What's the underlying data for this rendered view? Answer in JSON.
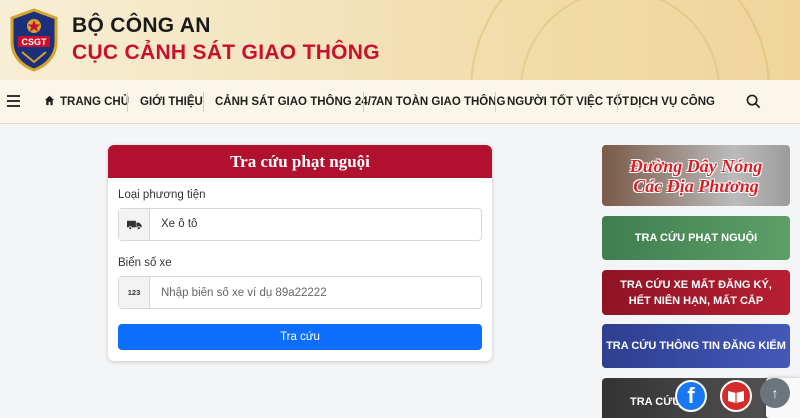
{
  "header": {
    "title_line1": "BỘ CÔNG AN",
    "title_line2": "CỤC CẢNH SÁT GIAO THÔNG",
    "logo_text": "CSGT"
  },
  "nav": {
    "items": [
      {
        "label": "TRANG CHỦ",
        "icon": "home-icon"
      },
      {
        "label": "GIỚI THIỆU"
      },
      {
        "label": "CẢNH SÁT GIAO THÔNG 24/7"
      },
      {
        "label": "AN TOÀN GIAO THÔNG"
      },
      {
        "label": "NGƯỜI TỐT VIỆC TỐT"
      },
      {
        "label": "DỊCH VỤ CÔNG"
      }
    ],
    "menu_icon": "hamburger-icon",
    "search_icon": "search-icon"
  },
  "form": {
    "title": "Tra cứu phạt nguội",
    "vehicle_type_label": "Loại phương tiện",
    "vehicle_type_value": "Xe ô tô",
    "plate_label": "Biển số xe",
    "plate_prefix": "123",
    "plate_placeholder": "Nhập biển số xe ví dụ 89a22222",
    "submit_label": "Tra cứu"
  },
  "sidebar": {
    "hotline_line1": "Đường Dây Nóng",
    "hotline_line2": "Các Địa Phương",
    "links": [
      {
        "label": "TRA CỨU PHẠT NGUỘI",
        "color": "#4f8f5b"
      },
      {
        "label": "TRA CỨU XE MẤT ĐĂNG KÝ, HẾT NIÊN HẠN, MẤT CẮP",
        "color": "#a51a2c"
      },
      {
        "label": "TRA CỨU THÔNG TIN ĐĂNG KIỂM",
        "color": "#3a4ca5"
      },
      {
        "label": "TRA CỨU",
        "color": "#444444"
      }
    ]
  },
  "floating": {
    "facebook_glyph": "f",
    "up_glyph": "↑"
  },
  "colors": {
    "brand_red": "#c8102e",
    "card_header": "#b2102f",
    "primary_button": "#0d6efd"
  }
}
